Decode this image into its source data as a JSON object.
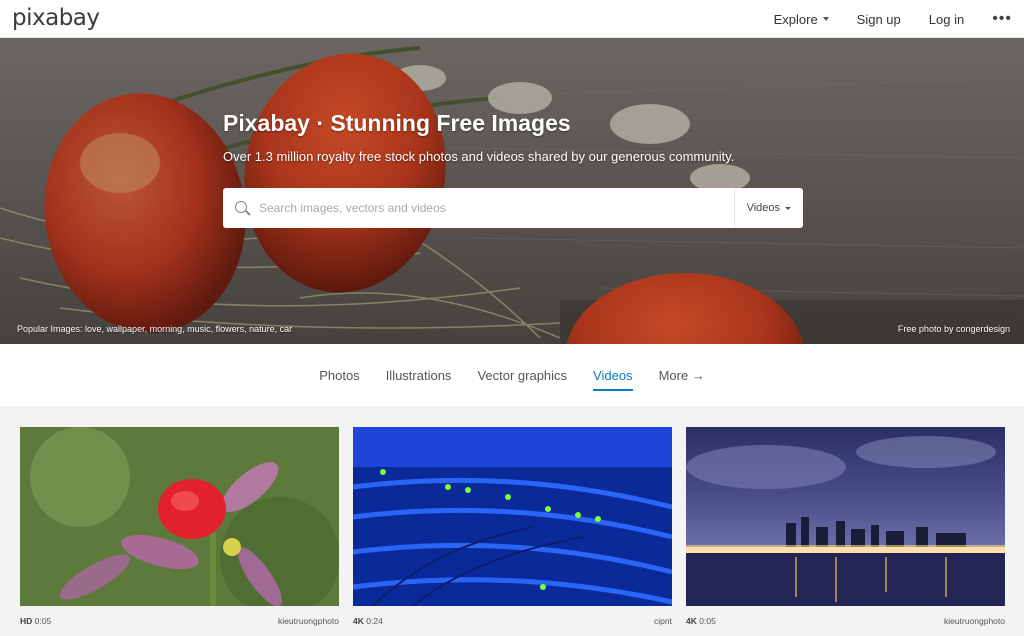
{
  "brand": {
    "logo": "pixabay"
  },
  "nav": {
    "explore": "Explore",
    "signup": "Sign up",
    "login": "Log in",
    "more": "•••"
  },
  "hero": {
    "title": "Pixabay · Stunning Free Images",
    "subtitle": "Over 1.3 million royalty free stock photos and videos shared by our generous community.",
    "search_placeholder": "Search images, vectors and videos",
    "search_type": "Videos",
    "popular": "Popular Images: love, wallpaper, morning, music, flowers, nature, car",
    "credit": "Free photo by congerdesign"
  },
  "tabs": [
    {
      "label": "Photos"
    },
    {
      "label": "Illustrations"
    },
    {
      "label": "Vector graphics"
    },
    {
      "label": "Videos",
      "active": true
    },
    {
      "label": "More →"
    }
  ],
  "videos": [
    {
      "quality": "HD",
      "duration": "0:05",
      "author": "kieutruongphoto"
    },
    {
      "quality": "4K",
      "duration": "0:24",
      "author": "cipnt"
    },
    {
      "quality": "4K",
      "duration": "0:05",
      "author": "kieutruongphoto"
    }
  ],
  "colors": {
    "accent": "#0a7ac7"
  }
}
